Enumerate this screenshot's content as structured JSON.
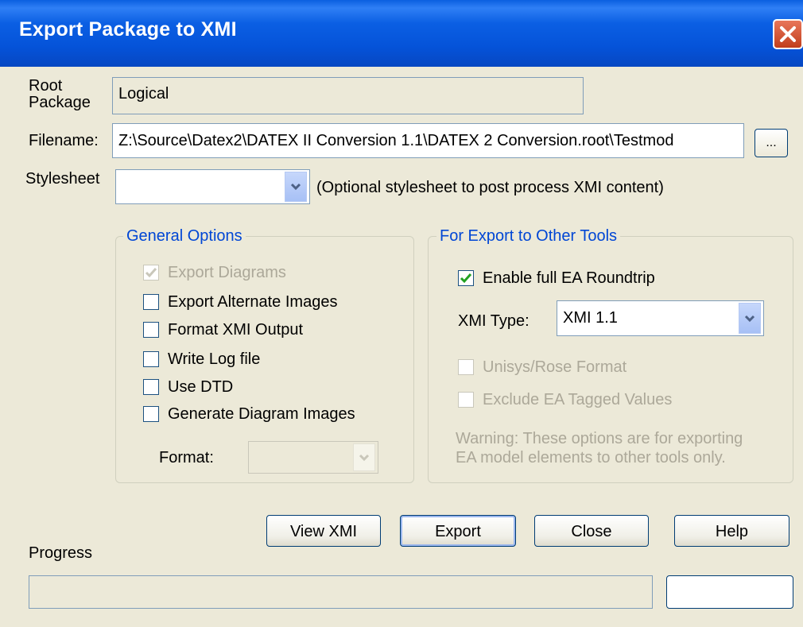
{
  "window": {
    "title": "Export Package to XMI"
  },
  "root_package": {
    "label": "Root Package",
    "value": "Logical"
  },
  "filename": {
    "label": "Filename:",
    "value": "Z:\\Source\\Datex2\\DATEX II Conversion 1.1\\DATEX 2 Conversion.root\\Testmod",
    "browse_label": "..."
  },
  "stylesheet": {
    "label": "Stylesheet",
    "value": "",
    "hint": "(Optional stylesheet to post process XMI content)"
  },
  "general_options": {
    "title": "General Options",
    "items": [
      {
        "label": "Export Diagrams",
        "checked": true,
        "enabled": false
      },
      {
        "label": "Export Alternate Images",
        "checked": false,
        "enabled": true
      },
      {
        "label": "Format XMI Output",
        "checked": false,
        "enabled": true
      },
      {
        "label": "Write Log file",
        "checked": false,
        "enabled": true
      },
      {
        "label": "Use DTD",
        "checked": false,
        "enabled": true
      },
      {
        "label": "Generate Diagram Images",
        "checked": false,
        "enabled": true
      }
    ],
    "format_label": "Format:",
    "format_value": ""
  },
  "other_tools": {
    "title": "For Export to Other Tools",
    "roundtrip_label": "Enable full EA Roundtrip",
    "roundtrip_checked": true,
    "xmi_type_label": "XMI Type:",
    "xmi_type_value": "XMI 1.1",
    "unisys_label": "Unisys/Rose Format",
    "exclude_label": "Exclude EA Tagged Values",
    "warning_line1": "Warning: These options are for exporting",
    "warning_line2": "EA model elements to other tools only."
  },
  "buttons": {
    "view_xmi": "View XMI",
    "export": "Export",
    "close": "Close",
    "help": "Help"
  },
  "progress": {
    "label": "Progress",
    "value": 0
  },
  "colors": {
    "titlebar": "#0553d9",
    "face": "#ece9d8",
    "group_title": "#0046d5",
    "disabled_text": "#aca899"
  }
}
